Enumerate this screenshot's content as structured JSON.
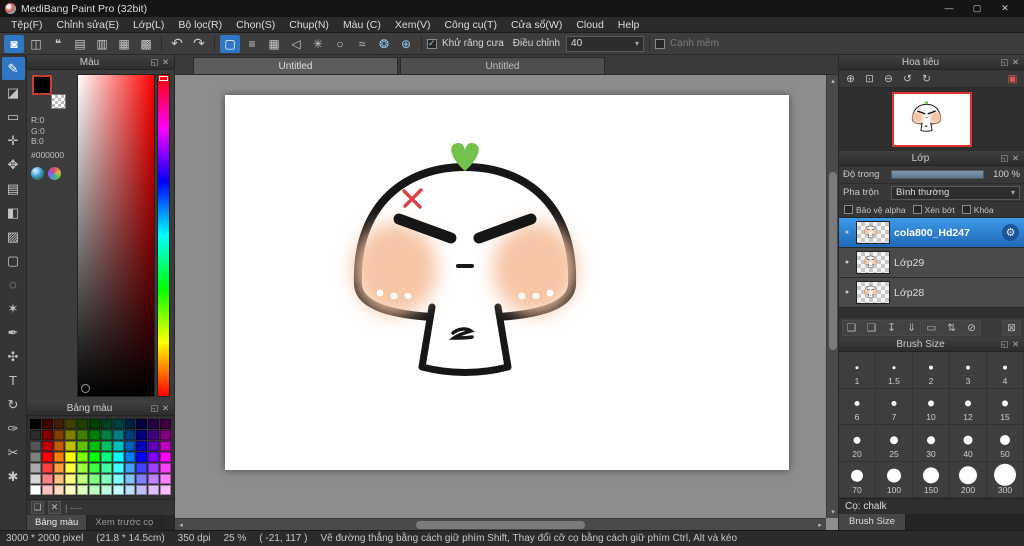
{
  "window": {
    "title": "MediBang Paint Pro (32bit)",
    "controls": {
      "minimize": "—",
      "maximize": "▢",
      "close": "✕"
    }
  },
  "icons": {
    "chevron": "▾",
    "popout": "◱",
    "close": "✕"
  },
  "menu_items": [
    "Tệp(F)",
    "Chỉnh sửa(E)",
    "Lớp(L)",
    "Bộ lọc(R)",
    "Chọn(S)",
    "Chụp(N)",
    "Màu (C)",
    "Xem(V)",
    "Công cụ(T)",
    "Cửa sổ(W)",
    "Cloud",
    "Help"
  ],
  "toolbar": {
    "file_icons": [
      {
        "name": "paint-mode-icon",
        "glyph": "◙",
        "selected": true
      },
      {
        "name": "upload-icon",
        "glyph": "◫"
      },
      {
        "name": "comment-icon",
        "glyph": "❝"
      },
      {
        "name": "note-icon",
        "glyph": "▤"
      },
      {
        "name": "pages-icon",
        "glyph": "▥"
      },
      {
        "name": "grid-icon",
        "glyph": "▦"
      },
      {
        "name": "panels-icon",
        "glyph": "▩"
      }
    ],
    "undo_icon": "↶",
    "redo_icon": "↷",
    "option_icons": [
      {
        "name": "rounded-select-icon",
        "glyph": "▢",
        "selected": true
      },
      {
        "name": "ruled-lines-icon",
        "glyph": "≡"
      },
      {
        "name": "mesh-grid-icon",
        "glyph": "▦"
      },
      {
        "name": "triangle-ruler-icon",
        "glyph": "◁"
      },
      {
        "name": "symmetry-icon",
        "glyph": "✳"
      },
      {
        "name": "ellipse-guide-icon",
        "glyph": "○"
      },
      {
        "name": "curve-guide-icon",
        "glyph": "≈"
      },
      {
        "name": "gear-guide-icon",
        "glyph": "❂",
        "accent": true
      },
      {
        "name": "crosshair-guide-icon",
        "glyph": "⊕",
        "accent": true
      }
    ],
    "antialias_label": "Khử răng cưa",
    "adjust_label": "Điều chỉnh",
    "adjust_value": "40",
    "soft_edge_label": "Cạnh mềm"
  },
  "tools": [
    {
      "name": "brush-tool",
      "glyph": "✎",
      "selected": true
    },
    {
      "name": "eraser-tool",
      "glyph": "◪"
    },
    {
      "name": "rect-brush-tool",
      "glyph": "▭"
    },
    {
      "name": "dot-tool",
      "glyph": "✛"
    },
    {
      "name": "move-tool",
      "glyph": "✥"
    },
    {
      "name": "fill-rect-tool",
      "glyph": "▤"
    },
    {
      "name": "bucket-tool",
      "glyph": "◧"
    },
    {
      "name": "gradient-tool",
      "glyph": "▨"
    },
    {
      "name": "select-tool",
      "glyph": "▢"
    },
    {
      "name": "lasso-tool",
      "glyph": "◌"
    },
    {
      "name": "magic-wand-tool",
      "glyph": "✶"
    },
    {
      "name": "pen-tool",
      "glyph": "✒"
    },
    {
      "name": "stamp-tool",
      "glyph": "✣"
    },
    {
      "name": "text-tool",
      "glyph": "T"
    },
    {
      "name": "rotate-tool",
      "glyph": "↻"
    },
    {
      "name": "eyedropper-tool",
      "glyph": "✑"
    },
    {
      "name": "slice-tool",
      "glyph": "✂"
    },
    {
      "name": "hand-tool",
      "glyph": "✱"
    }
  ],
  "color": {
    "title": "Màu",
    "r": "R:0",
    "g": "G:0",
    "b": "B:0",
    "hex": "#000000"
  },
  "palette": {
    "title": "Bảng màu",
    "empty_label": "| ----",
    "add_icon": "❏",
    "delete_icon": "✕"
  },
  "palette_colors": [
    "#000000",
    "#400000",
    "#402000",
    "#404000",
    "#204000",
    "#004000",
    "#004020",
    "#004040",
    "#002040",
    "#000040",
    "#200040",
    "#400040",
    "#2b2b2b",
    "#800000",
    "#804000",
    "#808000",
    "#408000",
    "#008000",
    "#008040",
    "#008080",
    "#004080",
    "#000080",
    "#400080",
    "#800080",
    "#555555",
    "#bf0000",
    "#bf6000",
    "#bfbf00",
    "#60bf00",
    "#00bf00",
    "#00bf60",
    "#00bfbf",
    "#0060bf",
    "#0000bf",
    "#6000bf",
    "#bf00bf",
    "#808080",
    "#ff0000",
    "#ff8000",
    "#ffff00",
    "#80ff00",
    "#00ff00",
    "#00ff80",
    "#00ffff",
    "#0080ff",
    "#0000ff",
    "#8000ff",
    "#ff00ff",
    "#aaaaaa",
    "#ff4040",
    "#ffa040",
    "#ffff40",
    "#a0ff40",
    "#40ff40",
    "#40ffa0",
    "#40ffff",
    "#40a0ff",
    "#4040ff",
    "#a040ff",
    "#ff40ff",
    "#d4d4d4",
    "#ff8080",
    "#ffc080",
    "#ffff80",
    "#c0ff80",
    "#80ff80",
    "#80ffc0",
    "#80ffff",
    "#80c0ff",
    "#8080ff",
    "#c080ff",
    "#ff80ff",
    "#ffffff",
    "#ffbfbf",
    "#ffdfbf",
    "#ffffbf",
    "#dfffbf",
    "#bfffbf",
    "#bfffdf",
    "#bfffff",
    "#bfdfff",
    "#bfbfff",
    "#dfbfff",
    "#ffbfff"
  ],
  "left_tabs": {
    "palette": "Bảng màu",
    "preview": "Xem trước cọ"
  },
  "canvas": {
    "tabs": [
      "Untitled",
      "Untitled"
    ]
  },
  "navigator": {
    "title": "Hoa tiêu",
    "icons": [
      {
        "name": "zoom-in-icon",
        "glyph": "⊕"
      },
      {
        "name": "zoom-reset-icon",
        "glyph": "⊡"
      },
      {
        "name": "zoom-out-icon",
        "glyph": "⊖"
      },
      {
        "name": "rotate-left-icon",
        "glyph": "↺"
      },
      {
        "name": "rotate-right-icon",
        "glyph": "↻"
      },
      {
        "name": "fit-view-icon",
        "glyph": "▣",
        "accent": true,
        "push": true
      }
    ]
  },
  "layers": {
    "title": "Lớp",
    "opacity_label": "Độ trong",
    "opacity_value": "100 %",
    "blend_label": "Pha trộn",
    "blend_value": "Bình thường",
    "options": [
      "Bảo vệ alpha",
      "Xén bớt",
      "Khóa"
    ],
    "items": [
      {
        "name": "cola800_Hd247",
        "selected": true
      },
      {
        "name": "Lớp29",
        "selected": false
      },
      {
        "name": "Lớp28",
        "selected": false
      }
    ],
    "actions": [
      {
        "name": "new-layer-icon",
        "glyph": "❏"
      },
      {
        "name": "duplicate-layer-icon",
        "glyph": "❑"
      },
      {
        "name": "import-layer-icon",
        "glyph": "↧"
      },
      {
        "name": "merge-layer-icon",
        "glyph": "⇓"
      },
      {
        "name": "folder-icon",
        "glyph": "▭"
      },
      {
        "name": "move-layer-icon",
        "glyph": "⇅"
      },
      {
        "name": "clear-layer-icon",
        "glyph": "⊘"
      },
      {
        "name": "delete-layer-icon",
        "glyph": "⊠",
        "push": true
      }
    ]
  },
  "brush": {
    "title": "Brush Size",
    "sizes": [
      "1",
      "1.5",
      "2",
      "3",
      "4",
      "6",
      "7",
      "10",
      "12",
      "15",
      "20",
      "25",
      "30",
      "40",
      "50",
      "70",
      "100",
      "150",
      "200",
      "300"
    ],
    "footer_label": "Cọ: chalk",
    "footer_tab": "Brush Size"
  },
  "status": {
    "pixels": "3000 * 2000 pixel",
    "cm": "(21.8 * 14.5cm)",
    "dpi": "350 dpi",
    "zoom": "25 %",
    "coords": "( -21, 117 )",
    "hint": "Vẽ đường thẳng bằng cách giữ phím Shift, Thay đổi cỡ cọ bằng cách giữ phím Ctrl, Alt và kéo"
  }
}
